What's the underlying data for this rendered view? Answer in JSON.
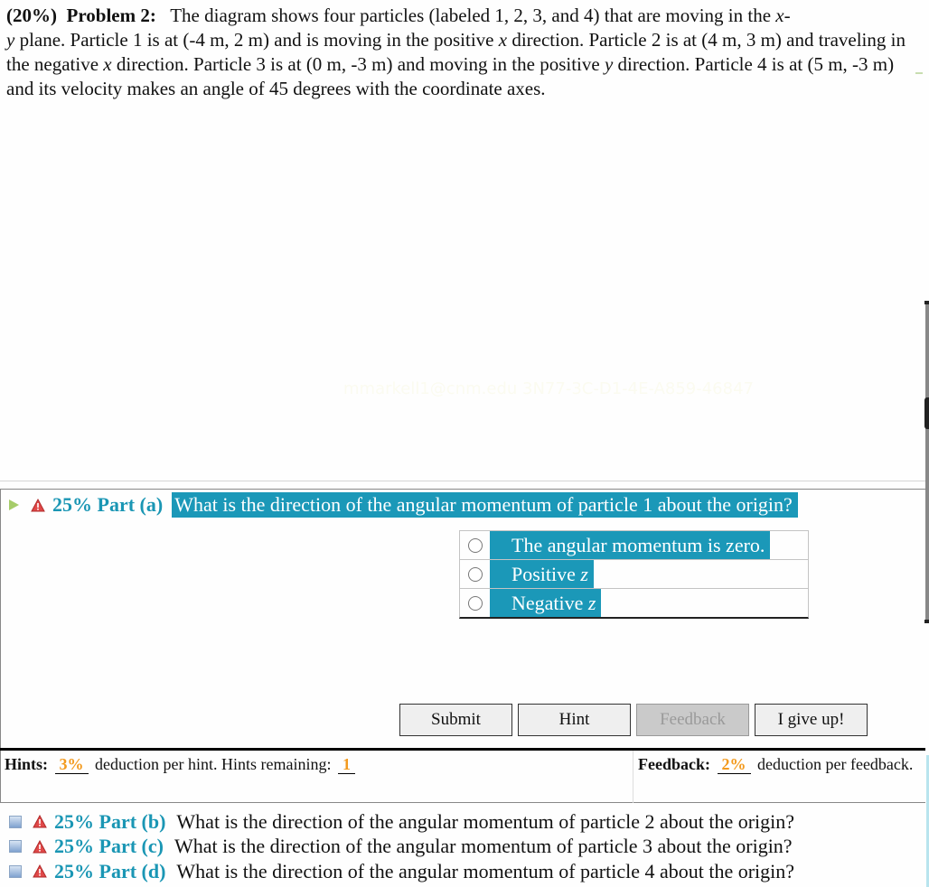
{
  "problem": {
    "weight": "(20%)",
    "title": "Problem 2:",
    "text_parts": [
      "The diagram shows four particles (labeled 1, 2, 3, and 4) that are moving in the ",
      "x",
      "-",
      "y",
      " plane. Particle 1 is at (-4 m, 2 m) and is moving in the positive ",
      "x",
      " direction. Particle 2 is at (4 m, 3 m) and traveling in the negative ",
      "x",
      " direction. Particle 3 is at (0 m, -3 m) and moving in the positive ",
      "y",
      " direction. Particle 4 is at (5 m, -3 m) and its velocity makes an angle of 45 degrees with the coordinate axes."
    ]
  },
  "watermark": "mmarkell1@cnm.edu 3N77-3C-D1-4E-A859-46847",
  "part_a": {
    "percent_label": "25% Part (a)",
    "question": "What is the direction of the angular momentum of particle 1 about the origin?",
    "choices": [
      {
        "text": "The angular momentum is zero.",
        "var": ""
      },
      {
        "text": "Positive ",
        "var": "z"
      },
      {
        "text": "Negative ",
        "var": "z"
      }
    ],
    "buttons": {
      "submit": "Submit",
      "hint": "Hint",
      "feedback": "Feedback",
      "give_up": "I give up!"
    }
  },
  "hints": {
    "label": "Hints:",
    "deduction": "3%",
    "text": "deduction per hint. Hints remaining:",
    "remaining": "1"
  },
  "feedback": {
    "label": "Feedback:",
    "deduction": "2%",
    "text": "deduction per feedback."
  },
  "other_parts": [
    {
      "percent_label": "25% Part (b)",
      "question": "What is the direction of the angular momentum of particle 2 about the origin?"
    },
    {
      "percent_label": "25% Part (c)",
      "question": "What is the direction of the angular momentum of particle 3 about the origin?"
    },
    {
      "percent_label": "25% Part (d)",
      "question": "What is the direction of the angular momentum of particle 4 about the origin?"
    }
  ],
  "colors": {
    "accent": "#1b98b8",
    "part_label": "#1a96b4",
    "deduction": "#f39a1e",
    "warning": "#e04848"
  }
}
